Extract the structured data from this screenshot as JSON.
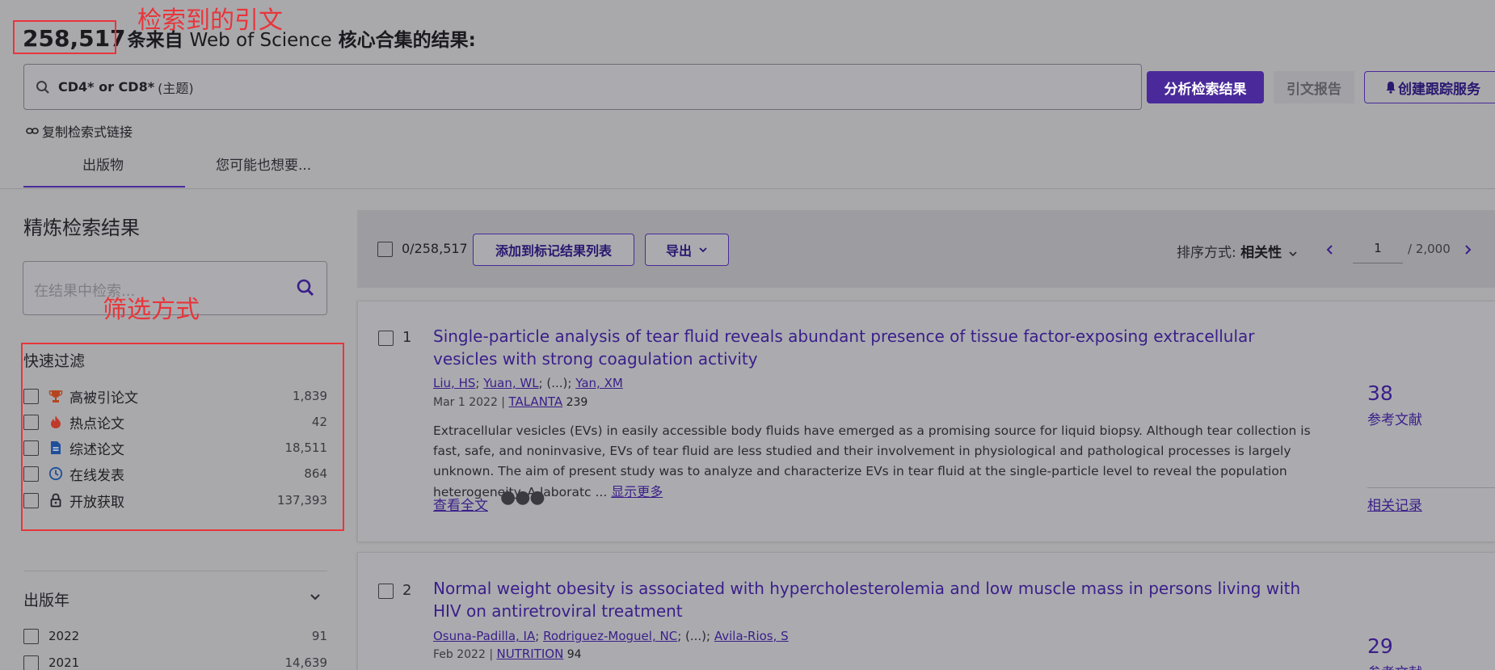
{
  "header": {
    "count": "258,517",
    "text_a": "条来自 ",
    "text_wos": "Web of Science",
    "text_b": " 核心合集的结果:"
  },
  "annotations": {
    "citations_found": "检索到的引文",
    "filter_method": "筛选方式"
  },
  "search": {
    "query_bold": "CD4* or CD8*",
    "query_suffix": "(主题)"
  },
  "actions": {
    "analyze": "分析检索结果",
    "citation_report": "引文报告",
    "create_alert": "创建跟踪服务"
  },
  "copy_link": "复制检索式链接",
  "tabs": [
    "出版物",
    "您可能也想要..."
  ],
  "refine": {
    "title": "精炼检索结果",
    "placeholder": "在结果中检索..."
  },
  "quick_filters": {
    "title": "快速过滤",
    "items": [
      {
        "label": "高被引论文",
        "count": "1,839",
        "icon": "trophy-icon",
        "color": "#b5451f"
      },
      {
        "label": "热点论文",
        "count": "42",
        "icon": "flame-icon",
        "color": "#c0392b"
      },
      {
        "label": "综述论文",
        "count": "18,511",
        "icon": "document-icon",
        "color": "#1f4f9a"
      },
      {
        "label": "在线发表",
        "count": "864",
        "icon": "clock-icon",
        "color": "#1f4f9a"
      },
      {
        "label": "开放获取",
        "count": "137,393",
        "icon": "lock-icon",
        "color": "#222228"
      }
    ]
  },
  "pub_year": {
    "title": "出版年",
    "items": [
      {
        "label": "2022",
        "count": "91"
      },
      {
        "label": "2021",
        "count": "14,639"
      }
    ]
  },
  "toolbar": {
    "selected": "0/258,517",
    "add_to_marked": "添加到标记结果列表",
    "export": "导出",
    "sort_label": "排序方式: ",
    "sort_value": "相关性",
    "page": "1",
    "page_total": "/  2,000"
  },
  "records": [
    {
      "num": "1",
      "title": "Single-particle analysis of tear fluid reveals abundant presence of tissue factor-exposing extracellular vesicles with strong coagulation activity",
      "author1": "Liu, HS",
      "author2": "Yuan, WL",
      "ellipsis": "; (...); ",
      "author3": "Yan, XM",
      "date": "Mar 1 2022 | ",
      "journal": "TALANTA",
      "volume": " 239",
      "abstract": "Extracellular vesicles (EVs) in easily accessible body fluids have emerged as a promising source for liquid biopsy. Although tear collection is fast, safe, and noninvasive, EVs of tear fluid are less studied and their involvement in physiological and pathological processes is largely unknown. The aim of present study was to analyze and characterize EVs in tear fluid at the single-particle level to reveal the population heterogeneity. A laboratc ...",
      "show_more": "显示更多",
      "full_text": "查看全文",
      "ref_count": "38",
      "ref_label": "参考文献",
      "related": "相关记录"
    },
    {
      "num": "2",
      "title": "Normal weight obesity is associated with hypercholesterolemia and low muscle mass in persons living with HIV on antiretroviral treatment",
      "author1": "Osuna-Padilla, IA",
      "author2": "Rodriguez-Moguel, NC",
      "ellipsis": "; (...); ",
      "author3": "Avila-Rios, S",
      "date": "Feb 2022 | ",
      "journal": "NUTRITION",
      "volume": " 94",
      "ref_count": "29",
      "ref_label": "参考文献"
    }
  ],
  "colors": {
    "accent": "#4a2a9a",
    "link": "#3a1e8a",
    "annotation": "#e8353a"
  }
}
